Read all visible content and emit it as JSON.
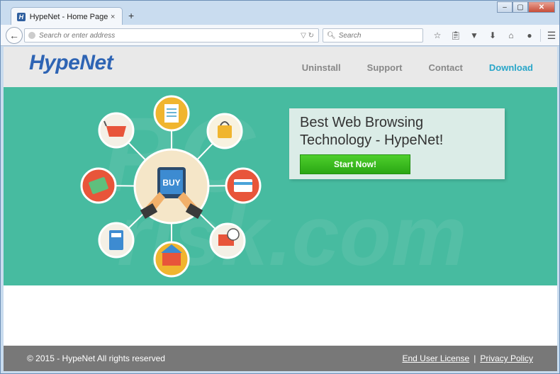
{
  "browser": {
    "tab_title": "HypeNet - Home Page",
    "tab_favicon": "H",
    "tab_close": "×",
    "new_tab": "+",
    "url_placeholder": "Search or enter address",
    "search_placeholder": "Search",
    "window_controls": {
      "minimize": "‒",
      "maximize": "▢",
      "close": "✕"
    },
    "toolbar_icons": [
      "star-icon",
      "clipboard-icon",
      "pocket-icon",
      "download-icon",
      "home-icon",
      "chat-icon",
      "menu-icon"
    ]
  },
  "site": {
    "logo": "HypeNet",
    "nav": [
      "Uninstall",
      "Support",
      "Contact",
      "Download"
    ],
    "active_nav": "Download"
  },
  "hero": {
    "headline": "Best Web Browsing Technology - HypeNet!",
    "cta": "Start Now!",
    "center_label": "BUY",
    "bg_color": "#47bba0"
  },
  "footer": {
    "copyright": "© 2015 - HypeNet All rights reserved",
    "links": [
      "End User License",
      "Privacy Policy"
    ],
    "separator": "|"
  }
}
